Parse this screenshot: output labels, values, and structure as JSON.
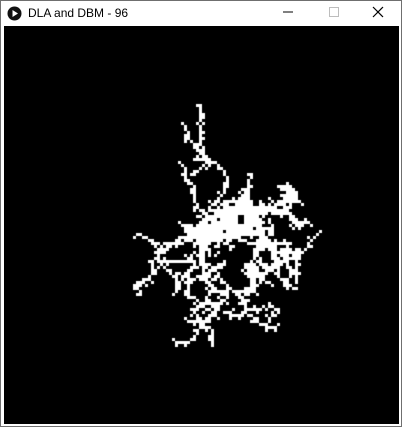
{
  "window": {
    "title": "DLA and DBM - 96",
    "buttons": {
      "minimize": "minimize-icon",
      "maximize": "maximize-icon",
      "close": "close-icon"
    }
  },
  "canvas": {
    "background": "#000000",
    "particle_color": "#ffffff"
  }
}
